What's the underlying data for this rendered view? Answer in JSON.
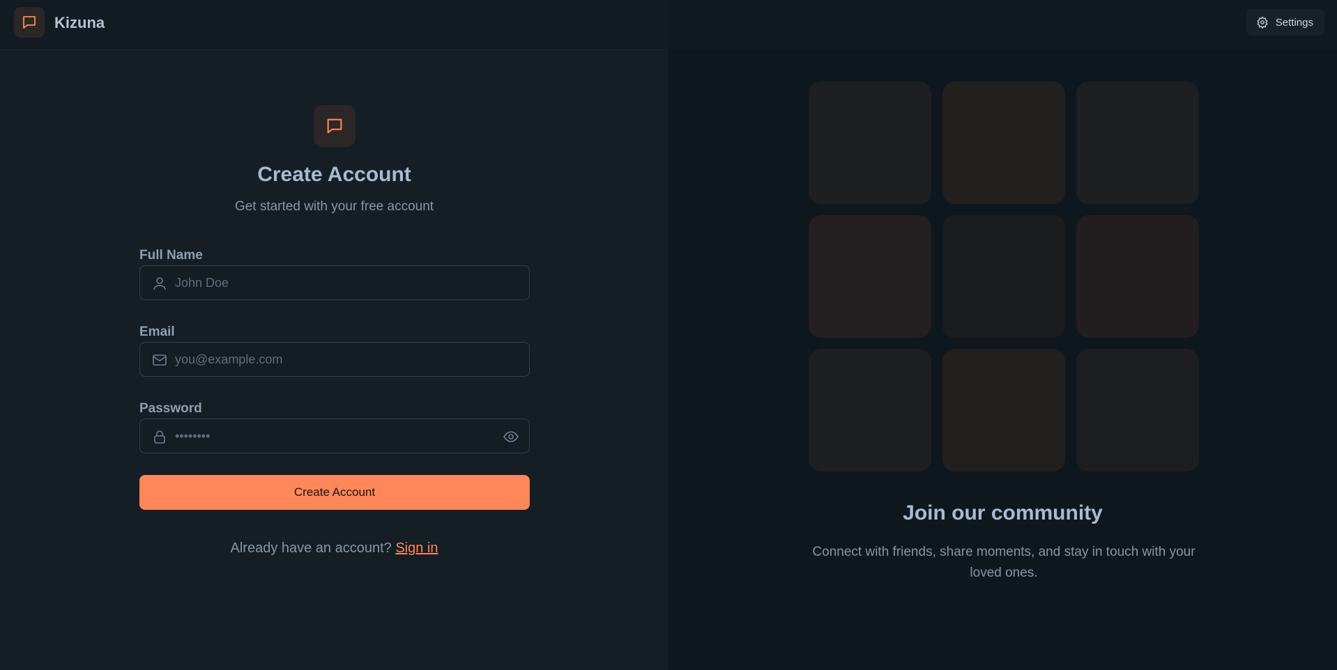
{
  "app": {
    "brand": "Kizuna"
  },
  "header": {
    "settings_label": "Settings"
  },
  "form": {
    "title": "Create Account",
    "subtitle": "Get started with your free account",
    "full_name": {
      "label": "Full Name",
      "placeholder": "John Doe"
    },
    "email": {
      "label": "Email",
      "placeholder": "you@example.com"
    },
    "password": {
      "label": "Password",
      "placeholder": "••••••••"
    },
    "submit_label": "Create Account",
    "signin_prompt": "Already have an account?",
    "signin_link": "Sign in"
  },
  "promo": {
    "title": "Join our community",
    "text": "Connect with friends, share moments, and stay in touch with your loved ones.",
    "tile_colors": [
      "#1d1f22",
      "#221f1f",
      "#1d1f22",
      "#231f20",
      "#1a1d20",
      "#221e1f",
      "#1d1f22",
      "#221f1f",
      "#1c1e21"
    ]
  },
  "colors": {
    "accent": "#ff875a",
    "background": "#151d25"
  }
}
